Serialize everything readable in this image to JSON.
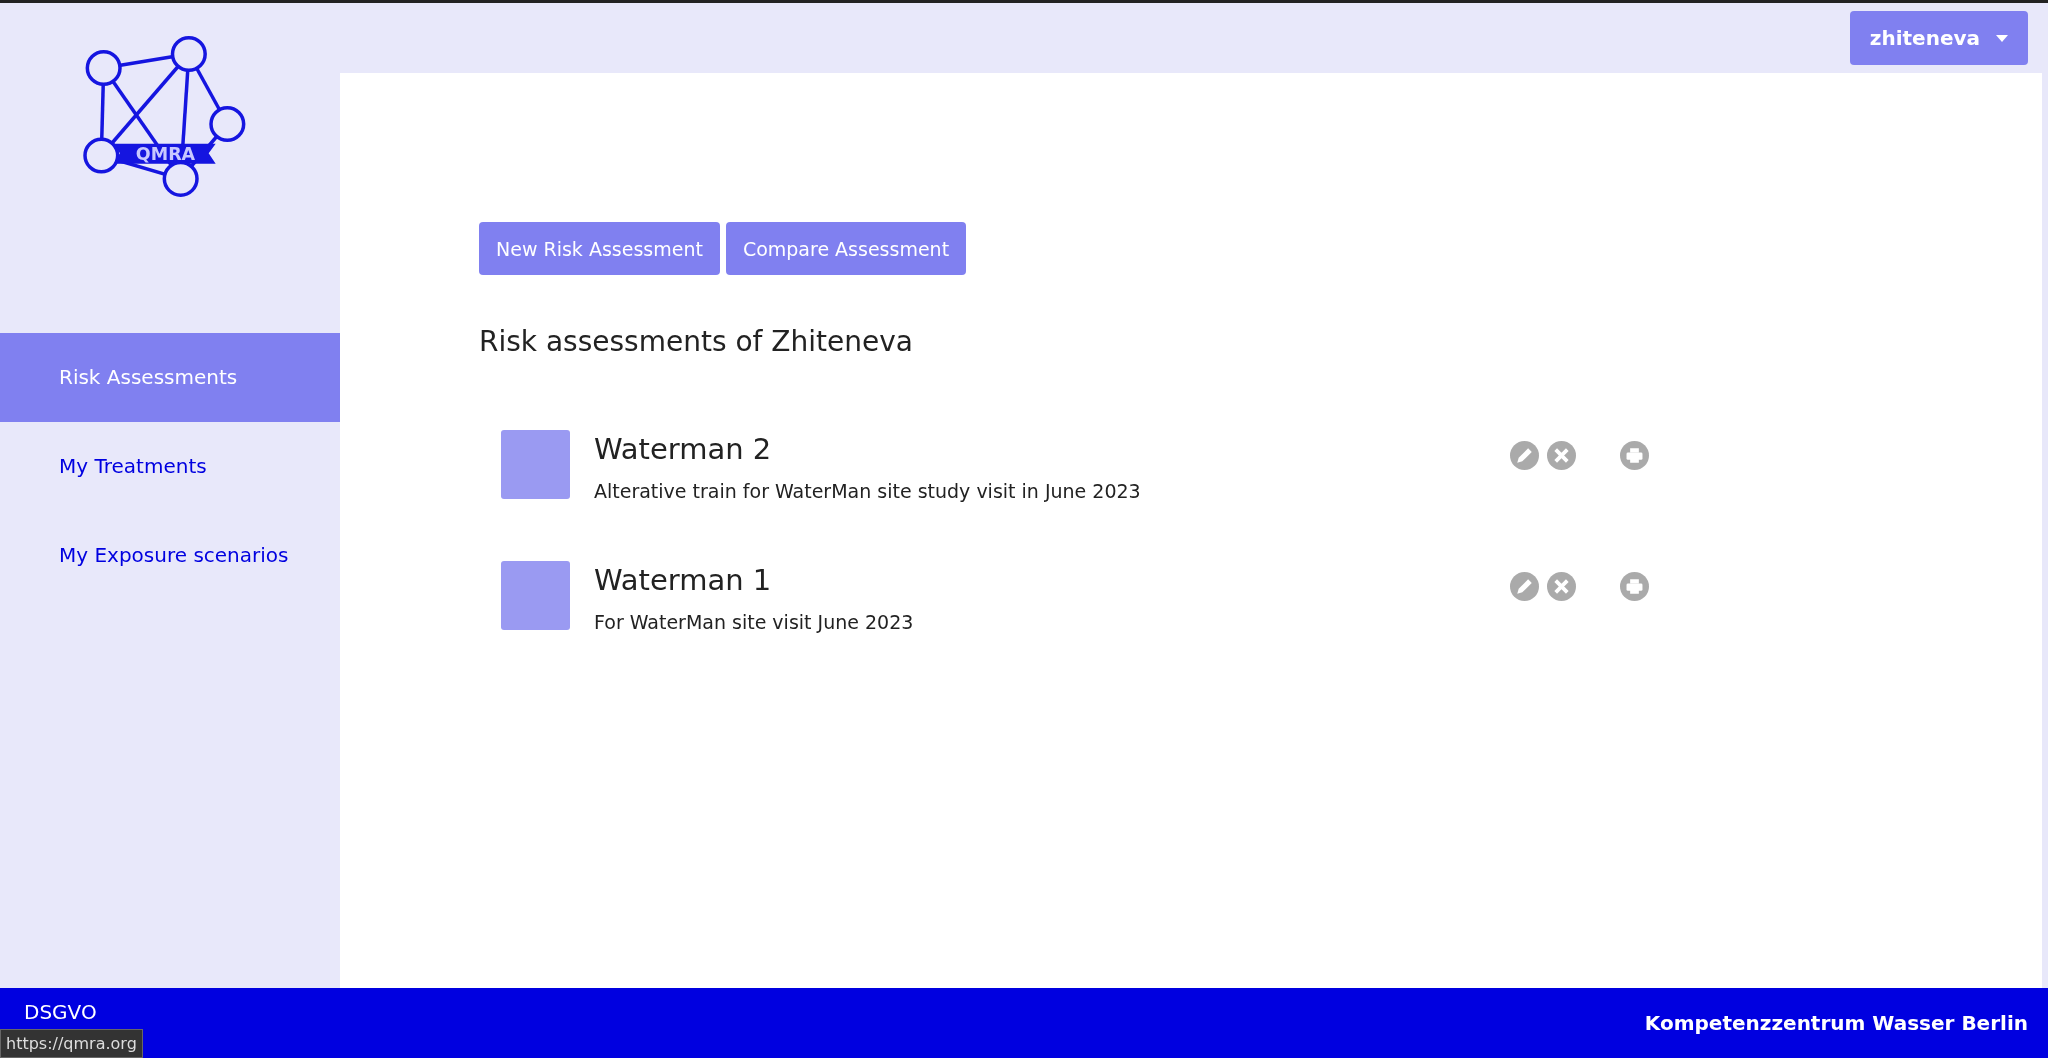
{
  "header": {
    "user_menu": "zhiteneva"
  },
  "logo": {
    "text": "QMRA"
  },
  "sidebar": {
    "items": [
      {
        "label": "Risk Assessments",
        "selected": true
      },
      {
        "label": "My Treatments",
        "selected": false
      },
      {
        "label": "My Exposure scenarios",
        "selected": false
      }
    ]
  },
  "toolbar": {
    "buttons": [
      "New Risk Assessment",
      "Compare Assessment"
    ]
  },
  "heading": "Risk assessments of Zhiteneva",
  "assessments": [
    {
      "title": "Waterman 2",
      "description": "Alterative train for WaterMan site study visit in June 2023"
    },
    {
      "title": "Waterman 1",
      "description": "For WaterMan site visit June 2023"
    }
  ],
  "footer": {
    "left_link": "DSGVO",
    "right_text": "Kompetenzzentrum Wasser Berlin"
  },
  "tooltip": "https://qmra.org"
}
